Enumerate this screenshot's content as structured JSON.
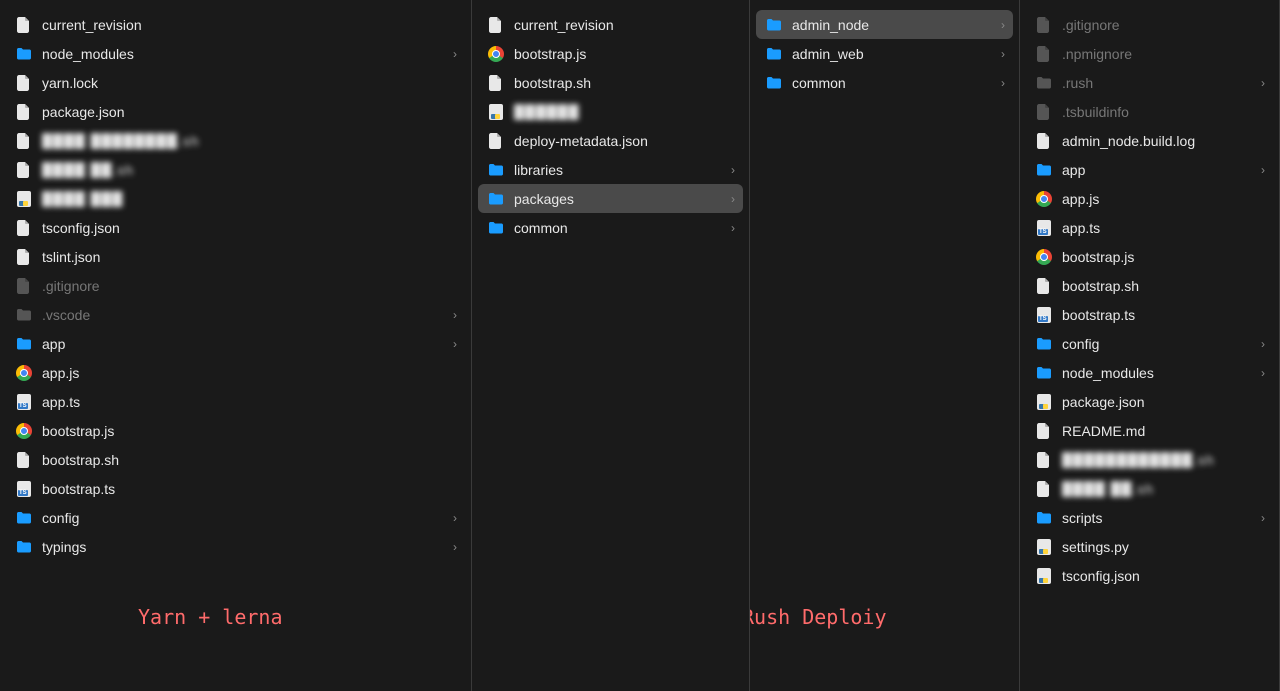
{
  "captions": {
    "left": "Yarn + lerna",
    "right": "Rush Deploiy"
  },
  "columns": [
    {
      "id": "col1",
      "items": [
        {
          "name": "current_revision",
          "icon": "file",
          "dim": false,
          "expandable": false
        },
        {
          "name": "node_modules",
          "icon": "folder",
          "dim": false,
          "expandable": true
        },
        {
          "name": "yarn.lock",
          "icon": "file",
          "dim": false,
          "expandable": false
        },
        {
          "name": "package.json",
          "icon": "file",
          "dim": false,
          "expandable": false
        },
        {
          "name": "████ ████████.sh",
          "icon": "file",
          "dim": false,
          "expandable": false,
          "blur": true
        },
        {
          "name": "████ ██.sh",
          "icon": "file",
          "dim": false,
          "expandable": false,
          "blur": true
        },
        {
          "name": "████ ███",
          "icon": "py",
          "dim": false,
          "expandable": false,
          "blur": true
        },
        {
          "name": "tsconfig.json",
          "icon": "file",
          "dim": false,
          "expandable": false
        },
        {
          "name": "tslint.json",
          "icon": "file",
          "dim": false,
          "expandable": false
        },
        {
          "name": ".gitignore",
          "icon": "file",
          "dim": true,
          "expandable": false
        },
        {
          "name": ".vscode",
          "icon": "folder",
          "dim": true,
          "expandable": true
        },
        {
          "name": "app",
          "icon": "folder",
          "dim": false,
          "expandable": true
        },
        {
          "name": "app.js",
          "icon": "chrome",
          "dim": false,
          "expandable": false
        },
        {
          "name": "app.ts",
          "icon": "ts",
          "dim": false,
          "expandable": false
        },
        {
          "name": "bootstrap.js",
          "icon": "chrome",
          "dim": false,
          "expandable": false
        },
        {
          "name": "bootstrap.sh",
          "icon": "file",
          "dim": false,
          "expandable": false
        },
        {
          "name": "bootstrap.ts",
          "icon": "ts",
          "dim": false,
          "expandable": false
        },
        {
          "name": "config",
          "icon": "folder",
          "dim": false,
          "expandable": true
        },
        {
          "name": "typings",
          "icon": "folder",
          "dim": false,
          "expandable": true
        }
      ]
    },
    {
      "id": "col2",
      "items": [
        {
          "name": "current_revision",
          "icon": "file",
          "dim": false,
          "expandable": false
        },
        {
          "name": "bootstrap.js",
          "icon": "chrome",
          "dim": false,
          "expandable": false
        },
        {
          "name": "bootstrap.sh",
          "icon": "file",
          "dim": false,
          "expandable": false
        },
        {
          "name": "██████",
          "icon": "py",
          "dim": false,
          "expandable": false,
          "blur": true
        },
        {
          "name": "deploy-metadata.json",
          "icon": "file",
          "dim": false,
          "expandable": false
        },
        {
          "name": "libraries",
          "icon": "folder",
          "dim": false,
          "expandable": true
        },
        {
          "name": "packages",
          "icon": "folder",
          "dim": false,
          "expandable": true,
          "selected": true
        },
        {
          "name": "common",
          "icon": "folder",
          "dim": false,
          "expandable": true
        }
      ]
    },
    {
      "id": "col3",
      "items": [
        {
          "name": "admin_node",
          "icon": "folder",
          "dim": false,
          "expandable": true,
          "selected": true
        },
        {
          "name": "admin_web",
          "icon": "folder",
          "dim": false,
          "expandable": true
        },
        {
          "name": "common",
          "icon": "folder",
          "dim": false,
          "expandable": true
        }
      ]
    },
    {
      "id": "col4",
      "items": [
        {
          "name": ".gitignore",
          "icon": "file",
          "dim": true,
          "expandable": false
        },
        {
          "name": ".npmignore",
          "icon": "file",
          "dim": true,
          "expandable": false
        },
        {
          "name": ".rush",
          "icon": "folder",
          "dim": true,
          "expandable": true
        },
        {
          "name": ".tsbuildinfo",
          "icon": "file",
          "dim": true,
          "expandable": false
        },
        {
          "name": "admin_node.build.log",
          "icon": "file",
          "dim": false,
          "expandable": false
        },
        {
          "name": "app",
          "icon": "folder",
          "dim": false,
          "expandable": true
        },
        {
          "name": "app.js",
          "icon": "chrome",
          "dim": false,
          "expandable": false
        },
        {
          "name": "app.ts",
          "icon": "ts",
          "dim": false,
          "expandable": false
        },
        {
          "name": "bootstrap.js",
          "icon": "chrome",
          "dim": false,
          "expandable": false
        },
        {
          "name": "bootstrap.sh",
          "icon": "file",
          "dim": false,
          "expandable": false
        },
        {
          "name": "bootstrap.ts",
          "icon": "ts",
          "dim": false,
          "expandable": false
        },
        {
          "name": "config",
          "icon": "folder",
          "dim": false,
          "expandable": true
        },
        {
          "name": "node_modules",
          "icon": "folder",
          "dim": false,
          "expandable": true
        },
        {
          "name": "package.json",
          "icon": "py",
          "dim": false,
          "expandable": false
        },
        {
          "name": "README.md",
          "icon": "file",
          "dim": false,
          "expandable": false
        },
        {
          "name": "████████████.sh",
          "icon": "file",
          "dim": false,
          "expandable": false,
          "blur": true
        },
        {
          "name": "████ ██.sh",
          "icon": "file",
          "dim": false,
          "expandable": false,
          "blur": true
        },
        {
          "name": "scripts",
          "icon": "folder",
          "dim": false,
          "expandable": true
        },
        {
          "name": "settings.py",
          "icon": "py",
          "dim": false,
          "expandable": false
        },
        {
          "name": "tsconfig.json",
          "icon": "py",
          "dim": false,
          "expandable": false
        }
      ]
    }
  ]
}
